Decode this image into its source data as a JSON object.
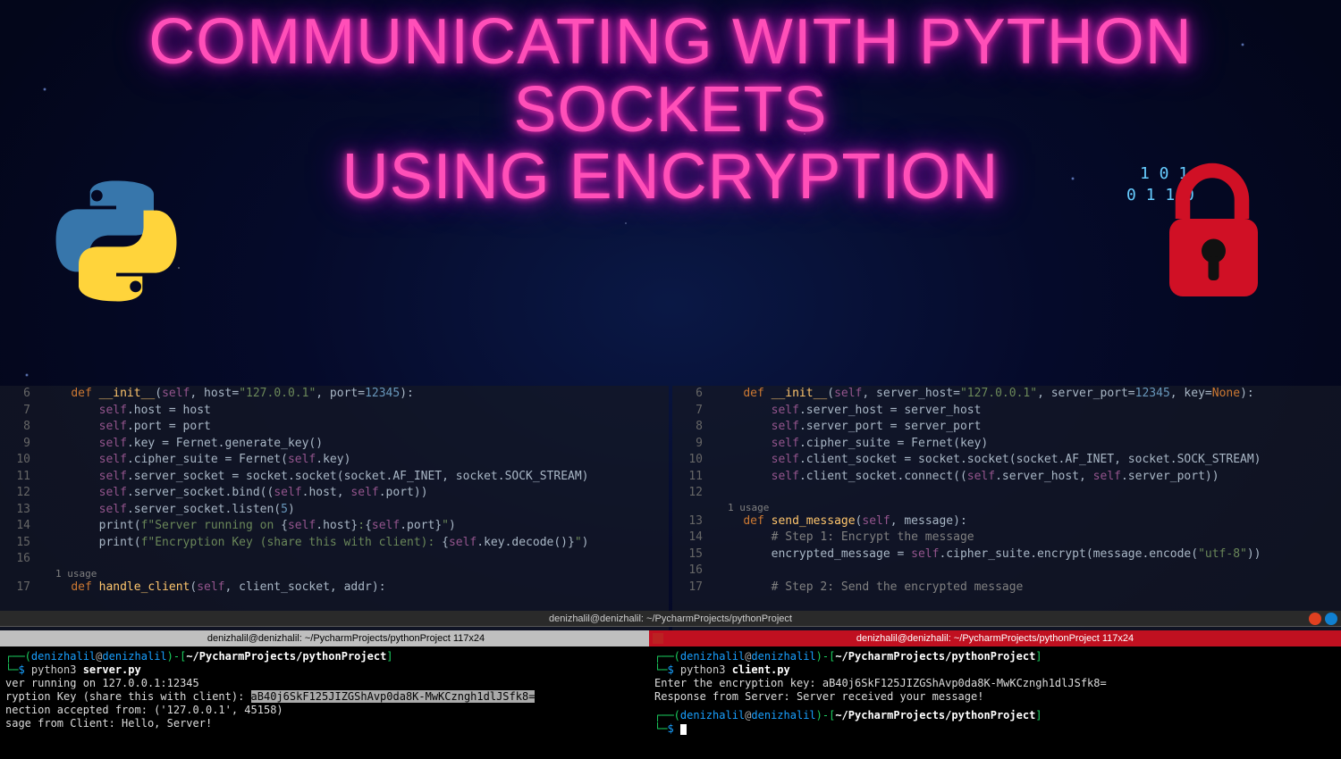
{
  "title": {
    "line1": "COMMUNICATING WITH PYTHON SOCKETS",
    "line2": "USING ENCRYPTION"
  },
  "left_code": {
    "lines": [
      {
        "n": 6,
        "i": 1,
        "seg": [
          [
            "kw",
            "def "
          ],
          [
            "fn",
            "__init__"
          ],
          [
            "",
            "("
          ],
          [
            "self",
            "self"
          ],
          [
            "",
            ", host="
          ],
          [
            "str",
            "\"127.0.0.1\""
          ],
          [
            "",
            ", port="
          ],
          [
            "num",
            "12345"
          ],
          [
            "",
            "):"
          ]
        ]
      },
      {
        "n": 7,
        "i": 2,
        "seg": [
          [
            "self",
            "self"
          ],
          [
            "",
            ".host = host"
          ]
        ]
      },
      {
        "n": 8,
        "i": 2,
        "seg": [
          [
            "self",
            "self"
          ],
          [
            "",
            ".port = port"
          ]
        ]
      },
      {
        "n": 9,
        "i": 2,
        "seg": [
          [
            "self",
            "self"
          ],
          [
            "",
            ".key = Fernet.generate_key()"
          ]
        ]
      },
      {
        "n": 10,
        "i": 2,
        "seg": [
          [
            "self",
            "self"
          ],
          [
            "",
            ".cipher_suite = Fernet("
          ],
          [
            "self",
            "self"
          ],
          [
            "",
            ".key)"
          ]
        ]
      },
      {
        "n": 11,
        "i": 2,
        "seg": [
          [
            "self",
            "self"
          ],
          [
            "",
            ".server_socket = socket.socket(socket.AF_INET, socket.SOCK_STREAM)"
          ]
        ]
      },
      {
        "n": 12,
        "i": 2,
        "seg": [
          [
            "self",
            "self"
          ],
          [
            "",
            ".server_socket.bind(("
          ],
          [
            "self",
            "self"
          ],
          [
            "",
            ".host, "
          ],
          [
            "self",
            "self"
          ],
          [
            "",
            ".port))"
          ]
        ]
      },
      {
        "n": 13,
        "i": 2,
        "seg": [
          [
            "self",
            "self"
          ],
          [
            "",
            ".server_socket.listen("
          ],
          [
            "num",
            "5"
          ],
          [
            "",
            ")"
          ]
        ]
      },
      {
        "n": 14,
        "i": 2,
        "seg": [
          [
            "",
            "print("
          ],
          [
            "str",
            "f\"Server running on "
          ],
          [
            "",
            "{"
          ],
          [
            "self",
            "self"
          ],
          [
            "",
            ".host}"
          ],
          [
            "str",
            ":"
          ],
          [
            "",
            "{"
          ],
          [
            "self",
            "self"
          ],
          [
            "",
            ".port}"
          ],
          [
            "str",
            "\""
          ],
          [
            "",
            ")"
          ]
        ]
      },
      {
        "n": 15,
        "i": 2,
        "seg": [
          [
            "",
            "print("
          ],
          [
            "str",
            "f\"Encryption Key (share this with client): "
          ],
          [
            "",
            "{"
          ],
          [
            "self",
            "self"
          ],
          [
            "",
            ".key.decode()}"
          ],
          [
            "str",
            "\""
          ],
          [
            "",
            ")"
          ]
        ]
      },
      {
        "n": 16,
        "i": 0,
        "seg": []
      },
      {
        "usage": "1 usage"
      },
      {
        "n": 17,
        "i": 1,
        "seg": [
          [
            "kw",
            "def "
          ],
          [
            "fn",
            "handle_client"
          ],
          [
            "",
            "("
          ],
          [
            "self",
            "self"
          ],
          [
            "",
            ", client_socket, addr):"
          ]
        ]
      }
    ]
  },
  "right_code": {
    "lines": [
      {
        "n": 6,
        "i": 1,
        "seg": [
          [
            "kw",
            "def "
          ],
          [
            "fn",
            "__init__"
          ],
          [
            "",
            "("
          ],
          [
            "self",
            "self"
          ],
          [
            "",
            ", server_host="
          ],
          [
            "str",
            "\"127.0.0.1\""
          ],
          [
            "",
            ", server_port="
          ],
          [
            "num",
            "12345"
          ],
          [
            "",
            ", key="
          ],
          [
            "kw",
            "None"
          ],
          [
            "",
            "):"
          ]
        ]
      },
      {
        "n": 7,
        "i": 2,
        "seg": [
          [
            "self",
            "self"
          ],
          [
            "",
            ".server_host = server_host"
          ]
        ]
      },
      {
        "n": 8,
        "i": 2,
        "seg": [
          [
            "self",
            "self"
          ],
          [
            "",
            ".server_port = server_port"
          ]
        ]
      },
      {
        "n": 9,
        "i": 2,
        "seg": [
          [
            "self",
            "self"
          ],
          [
            "",
            ".cipher_suite = Fernet(key)"
          ]
        ]
      },
      {
        "n": 10,
        "i": 2,
        "seg": [
          [
            "self",
            "self"
          ],
          [
            "",
            ".client_socket = socket.socket(socket.AF_INET, socket.SOCK_STREAM)"
          ]
        ]
      },
      {
        "n": 11,
        "i": 2,
        "seg": [
          [
            "self",
            "self"
          ],
          [
            "",
            ".client_socket.connect(("
          ],
          [
            "self",
            "self"
          ],
          [
            "",
            ".server_host, "
          ],
          [
            "self",
            "self"
          ],
          [
            "",
            ".server_port))"
          ]
        ]
      },
      {
        "n": 12,
        "i": 0,
        "seg": []
      },
      {
        "usage": "1 usage"
      },
      {
        "n": 13,
        "i": 1,
        "seg": [
          [
            "kw",
            "def "
          ],
          [
            "fn",
            "send_message"
          ],
          [
            "",
            "("
          ],
          [
            "self",
            "self"
          ],
          [
            "",
            ", message):"
          ]
        ]
      },
      {
        "n": 14,
        "i": 2,
        "seg": [
          [
            "cm",
            "# Step 1: Encrypt the message"
          ]
        ]
      },
      {
        "n": 15,
        "i": 2,
        "seg": [
          [
            "",
            "encrypted_message = "
          ],
          [
            "self",
            "self"
          ],
          [
            "",
            ".cipher_suite.encrypt(message.encode("
          ],
          [
            "str",
            "\"utf-8\""
          ],
          [
            "",
            "))"
          ]
        ]
      },
      {
        "n": 16,
        "i": 0,
        "seg": []
      },
      {
        "n": 17,
        "i": 2,
        "seg": [
          [
            "cm",
            "# Step 2: Send the encrypted message"
          ]
        ]
      }
    ]
  },
  "tab_bar": "denizhalil@denizhalil: ~/PycharmProjects/pythonProject",
  "terminal_left": {
    "header": "denizhalil@denizhalil: ~/PycharmProjects/pythonProject 117x24",
    "user": "denizhalil",
    "host": "denizhalil",
    "path": "~/PycharmProjects/pythonProject",
    "cmd": "python3 server.py",
    "out1": "ver running on 127.0.0.1:12345",
    "out2_pre": "ryption Key (share this with client): ",
    "out2_key": "aB40j6SkF125JIZGShAvp0da8K-MwKCzngh1dlJSfk8=",
    "out3": "nection accepted from: ('127.0.0.1', 45158)",
    "out4": "sage from Client: Hello, Server!"
  },
  "terminal_right": {
    "header": "denizhalil@denizhalil: ~/PycharmProjects/pythonProject 117x24",
    "user": "denizhalil",
    "host": "denizhalil",
    "path": "~/PycharmProjects/pythonProject",
    "cmd": "python3 client.py",
    "out1": "Enter the encryption key: aB40j6SkF125JIZGShAvp0da8K-MwKCzngh1dlJSfk8=",
    "out2": "Response from Server: Server received your message!"
  }
}
